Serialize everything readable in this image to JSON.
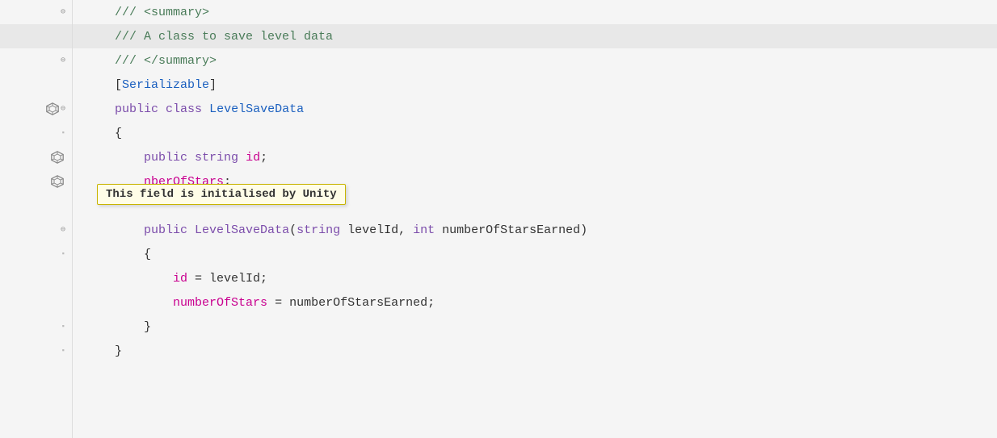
{
  "editor": {
    "background": "#f5f5f5",
    "lines": [
      {
        "id": 1,
        "indent": 1,
        "gutter": "collapse",
        "highlighted": false,
        "tokens": [
          {
            "text": "    /// <summary>",
            "class": "c-comment"
          }
        ]
      },
      {
        "id": 2,
        "indent": 1,
        "gutter": "",
        "highlighted": true,
        "tokens": [
          {
            "text": "    /// A class to save level data",
            "class": "c-comment"
          }
        ]
      },
      {
        "id": 3,
        "indent": 1,
        "gutter": "collapse",
        "highlighted": false,
        "tokens": [
          {
            "text": "    /// </summary>",
            "class": "c-comment"
          }
        ]
      },
      {
        "id": 4,
        "indent": 1,
        "gutter": "",
        "highlighted": false,
        "tokens": [
          {
            "text": "    [",
            "class": "c-bracket"
          },
          {
            "text": "Serializable",
            "class": "c-attribute"
          },
          {
            "text": "]",
            "class": "c-bracket"
          }
        ]
      },
      {
        "id": 5,
        "indent": 0,
        "gutter": "unity",
        "highlighted": false,
        "tokens": [
          {
            "text": "    ",
            "class": "c-plain"
          },
          {
            "text": "public",
            "class": "c-keyword"
          },
          {
            "text": " ",
            "class": "c-plain"
          },
          {
            "text": "class",
            "class": "c-keyword"
          },
          {
            "text": " ",
            "class": "c-plain"
          },
          {
            "text": "LevelSaveData",
            "class": "c-class-name"
          }
        ]
      },
      {
        "id": 6,
        "indent": 0,
        "gutter": "collapse-open",
        "highlighted": false,
        "tokens": [
          {
            "text": "    {",
            "class": "c-plain"
          }
        ]
      },
      {
        "id": 7,
        "indent": 1,
        "gutter": "unity",
        "highlighted": false,
        "tokens": [
          {
            "text": "        ",
            "class": "c-plain"
          },
          {
            "text": "public",
            "class": "c-keyword"
          },
          {
            "text": " ",
            "class": "c-plain"
          },
          {
            "text": "string",
            "class": "c-keyword"
          },
          {
            "text": " ",
            "class": "c-plain"
          },
          {
            "text": "id",
            "class": "c-field"
          },
          {
            "text": ";",
            "class": "c-plain"
          }
        ]
      },
      {
        "id": 8,
        "indent": 1,
        "gutter": "unity-tooltip",
        "highlighted": false,
        "tokens": [
          {
            "text": "        ",
            "class": "c-plain"
          },
          {
            "text": "nberOfStars",
            "class": "c-field"
          },
          {
            "text": ";",
            "class": "c-plain"
          }
        ]
      },
      {
        "id": 9,
        "indent": 1,
        "gutter": "",
        "highlighted": false,
        "tokens": [
          {
            "text": "",
            "class": "c-plain"
          }
        ]
      },
      {
        "id": 10,
        "indent": 1,
        "gutter": "collapse-sub",
        "highlighted": false,
        "tokens": [
          {
            "text": "        ",
            "class": "c-plain"
          },
          {
            "text": "public",
            "class": "c-keyword"
          },
          {
            "text": " ",
            "class": "c-plain"
          },
          {
            "text": "LevelSaveData",
            "class": "c-method"
          },
          {
            "text": "(",
            "class": "c-plain"
          },
          {
            "text": "string",
            "class": "c-keyword"
          },
          {
            "text": " levelId, ",
            "class": "c-plain"
          },
          {
            "text": "int",
            "class": "c-keyword"
          },
          {
            "text": " numberOfStarsEarned)",
            "class": "c-plain"
          }
        ]
      },
      {
        "id": 11,
        "indent": 1,
        "gutter": "collapse-open",
        "highlighted": false,
        "tokens": [
          {
            "text": "        {",
            "class": "c-plain"
          }
        ]
      },
      {
        "id": 12,
        "indent": 2,
        "gutter": "",
        "highlighted": false,
        "tokens": [
          {
            "text": "            ",
            "class": "c-plain"
          },
          {
            "text": "id",
            "class": "c-field"
          },
          {
            "text": " = levelId;",
            "class": "c-plain"
          }
        ]
      },
      {
        "id": 13,
        "indent": 2,
        "gutter": "",
        "highlighted": false,
        "tokens": [
          {
            "text": "            ",
            "class": "c-plain"
          },
          {
            "text": "numberOfStars",
            "class": "c-field"
          },
          {
            "text": " = numberOfStarsEarned;",
            "class": "c-plain"
          }
        ]
      },
      {
        "id": 14,
        "indent": 1,
        "gutter": "collapse-close",
        "highlighted": false,
        "tokens": [
          {
            "text": "        }",
            "class": "c-plain"
          }
        ]
      },
      {
        "id": 15,
        "indent": 0,
        "gutter": "collapse-close",
        "highlighted": false,
        "tokens": [
          {
            "text": "    }",
            "class": "c-plain"
          }
        ]
      }
    ],
    "tooltip": {
      "text": "This field is initialised by Unity",
      "visible": true
    }
  }
}
